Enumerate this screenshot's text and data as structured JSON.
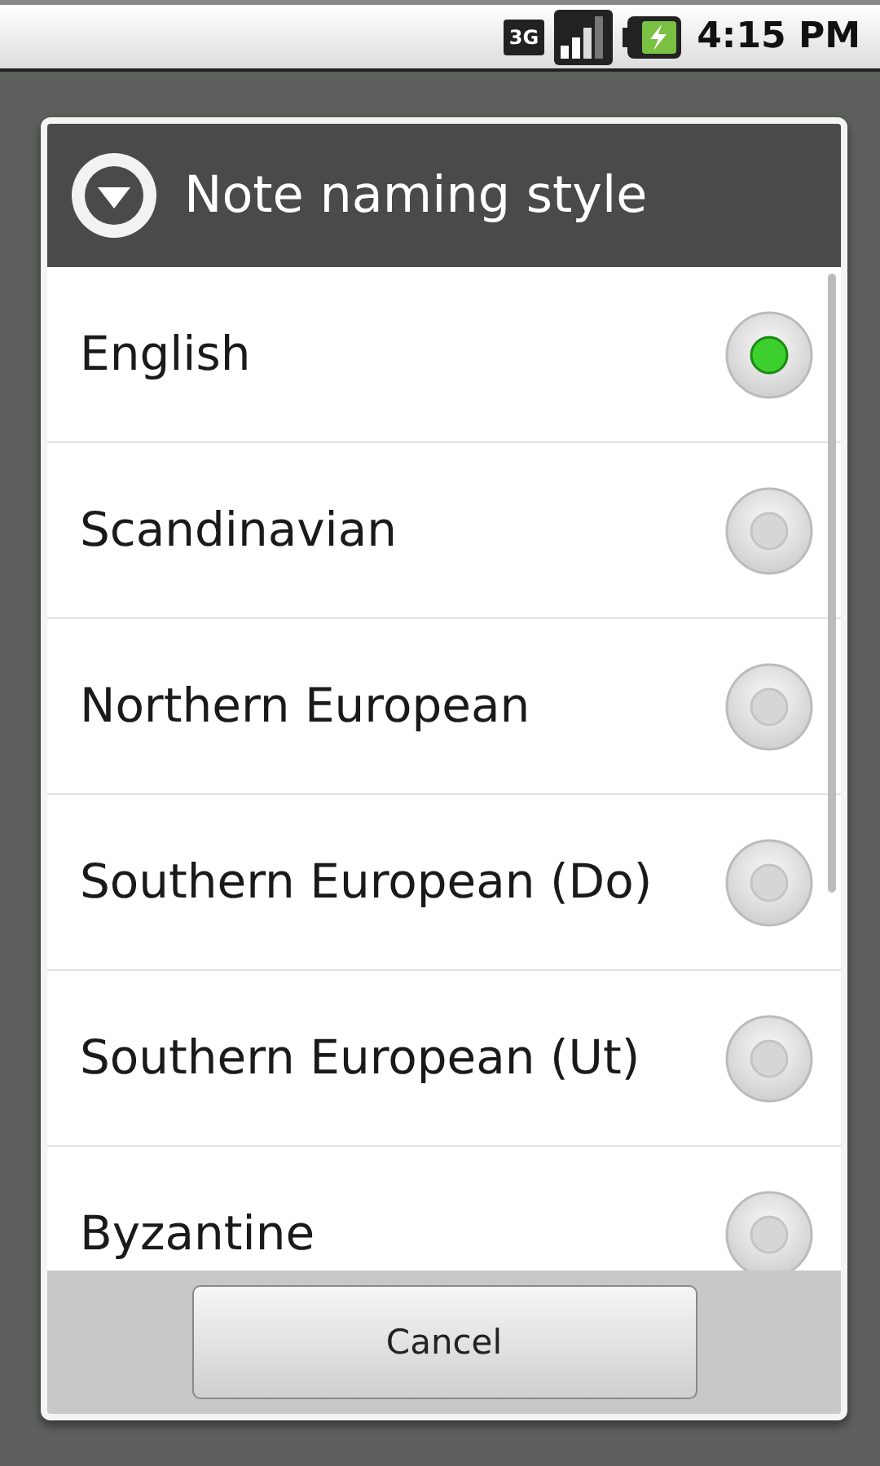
{
  "status_bar": {
    "network": "3G",
    "time": "4:15 PM"
  },
  "dialog": {
    "title": "Note naming style",
    "options": [
      {
        "label": "English",
        "selected": true
      },
      {
        "label": "Scandinavian",
        "selected": false
      },
      {
        "label": "Northern European",
        "selected": false
      },
      {
        "label": "Southern European (Do)",
        "selected": false
      },
      {
        "label": "Southern European (Ut)",
        "selected": false
      },
      {
        "label": "Byzantine",
        "selected": false
      }
    ],
    "buttons": [
      "Cancel"
    ]
  }
}
